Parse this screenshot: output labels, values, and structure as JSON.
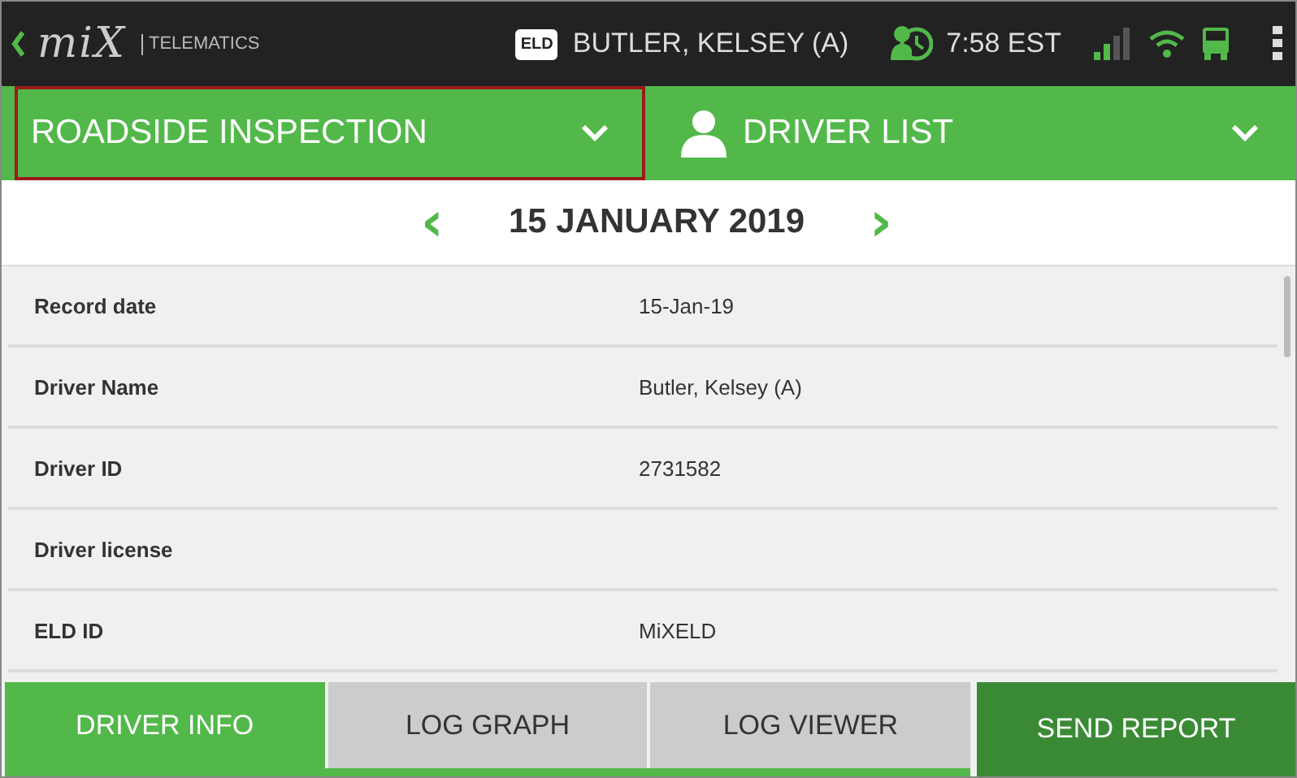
{
  "top_bar": {
    "logo": "miX",
    "logo_subtitle": "TELEMATICS",
    "eld_badge": "ELD",
    "driver": "BUTLER, KELSEY (A)",
    "time": "7:58 EST"
  },
  "header": {
    "inspection_dropdown": {
      "label": "ROADSIDE INSPECTION",
      "focused": true
    },
    "driver_dropdown": {
      "label": "DRIVER LIST"
    }
  },
  "date_nav": {
    "prev": "‹",
    "date": "15 JANUARY 2019",
    "next": "›"
  },
  "records": [
    {
      "label": "Record date",
      "value": "15-Jan-19"
    },
    {
      "label": "Driver Name",
      "value": "Butler, Kelsey (A)"
    },
    {
      "label": "Driver ID",
      "value": "2731582"
    },
    {
      "label": "Driver license"
    },
    {
      "label": "ELD ID",
      "value": "MiXELD"
    }
  ],
  "bottom_tabs": [
    {
      "label": "DRIVER INFO",
      "kind": "tab",
      "selected": true
    },
    {
      "label": "LOG GRAPH",
      "kind": "tab",
      "selected": false
    },
    {
      "label": "LOG VIEWER",
      "kind": "tab",
      "selected": false
    },
    {
      "label": "SEND REPORT",
      "kind": "action"
    }
  ]
}
